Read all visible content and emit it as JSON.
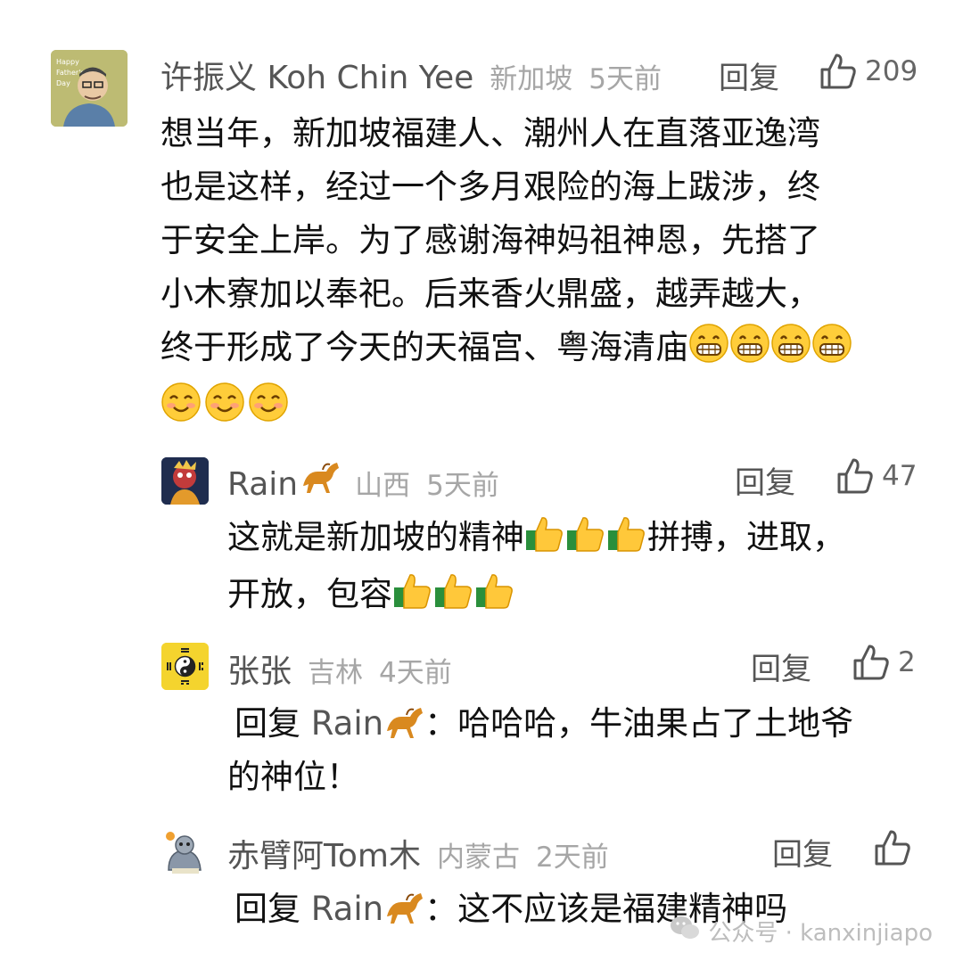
{
  "comments": [
    {
      "name": "许振义 Koh Chin Yee",
      "location": "新加坡",
      "time": "5天前",
      "reply_label": "回复",
      "likes": "209",
      "text_lines": [
        "想当年，新加坡福建人、潮州人在直落亚逸湾",
        "也是这样，经过一个多月艰险的海上跋涉，终",
        "于安全上岸。为了感谢海神妈祖神恩，先搭了",
        "小木寮加以奉祀。后来香火鼎盛，越弄越大，",
        "终于形成了今天的天福宫、粤海清庙"
      ],
      "emojis_after": [
        "grin-icon",
        "grin-icon",
        "grin-icon",
        "grin-icon",
        "smile-icon",
        "smile-icon",
        "smile-icon"
      ],
      "avatar_label": "Happy Father's Day"
    },
    {
      "name": "Rain",
      "location": "山西",
      "time": "5天前",
      "reply_label": "回复",
      "likes": "47",
      "text_a": "这就是新加坡的精神",
      "text_b": "拼搏，进取，",
      "text_c": "开放，包容"
    },
    {
      "name": "张张",
      "location": "吉林",
      "time": "4天前",
      "reply_label": "回复",
      "likes": "2",
      "prefix": "回复",
      "target": "Rain",
      "text_a": "：哈哈哈，牛油果占了土地爷",
      "text_b": "的神位！"
    },
    {
      "name": "赤臂阿Tom木",
      "location": "内蒙古",
      "time": "2天前",
      "reply_label": "回复",
      "likes": "",
      "prefix": "回复",
      "target": "Rain",
      "text_a": "：这不应该是福建精神吗"
    }
  ],
  "watermark": {
    "text": "公众号 · kanxinjiapo"
  },
  "colors": {
    "name": "#555555",
    "meta": "#a6a6a6",
    "text": "#111111",
    "avatar1_bg": "#b7b66a",
    "avatar3_bg": "#f2d330"
  }
}
